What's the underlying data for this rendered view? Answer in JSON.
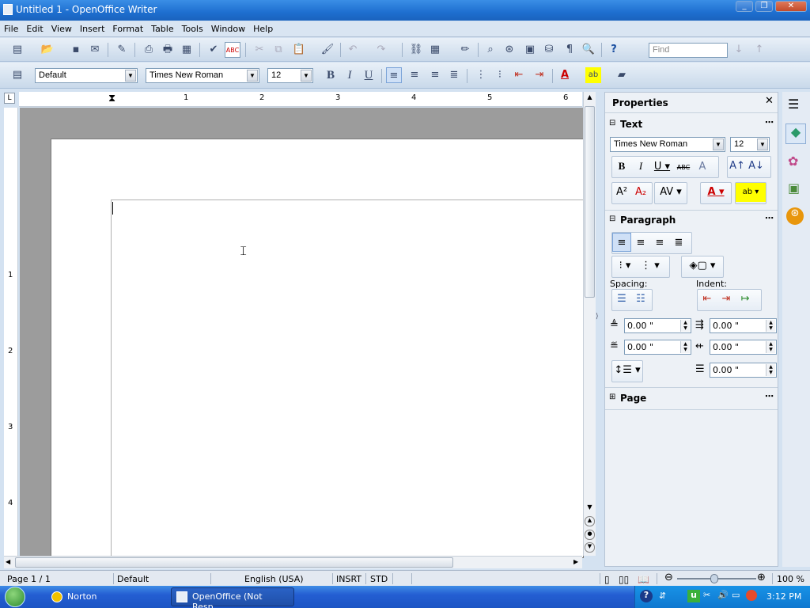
{
  "window": {
    "title": "Untitled 1 - OpenOffice Writer"
  },
  "menu": [
    "File",
    "Edit",
    "View",
    "Insert",
    "Format",
    "Table",
    "Tools",
    "Window",
    "Help"
  ],
  "toolbar": {
    "find_placeholder": "Find"
  },
  "format_bar": {
    "style": "Default",
    "font": "Times New Roman",
    "size": "12"
  },
  "ruler": {
    "h_numbers": [
      "1",
      "2",
      "3",
      "4",
      "5",
      "6"
    ],
    "v_numbers": [
      "1",
      "2",
      "3",
      "4"
    ]
  },
  "sidebar": {
    "title": "Properties",
    "text_section": {
      "title": "Text",
      "font": "Times New Roman",
      "size": "12"
    },
    "paragraph_section": {
      "title": "Paragraph",
      "spacing_label": "Spacing:",
      "indent_label": "Indent:",
      "above_spacing": "0.00 \"",
      "below_spacing": "0.00 \"",
      "before_indent": "0.00 \"",
      "after_indent": "0.00 \"",
      "first_line_indent": "0.00 \""
    },
    "page_section": {
      "title": "Page"
    }
  },
  "statusbar": {
    "page": "Page 1 / 1",
    "style": "Default",
    "language": "English (USA)",
    "insert_mode": "INSRT",
    "selection_mode": "STD",
    "zoom": "100 %"
  },
  "taskbar": {
    "items": [
      "Norton",
      "OpenOffice (Not Resp..."
    ],
    "clock": "3:12 PM"
  },
  "colors": {
    "accent": "#1e6fd0",
    "taskbar": "#245ed2"
  }
}
